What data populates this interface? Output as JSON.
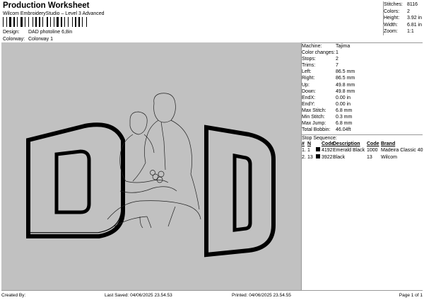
{
  "header": {
    "title": "Production Worksheet",
    "subtitle": "Wilcom EmbroideryStudio – Level 3 Advanced",
    "stats": [
      {
        "label": "Stitches:",
        "value": "8116"
      },
      {
        "label": "Colors:",
        "value": "2"
      },
      {
        "label": "Height:",
        "value": "3.92 in"
      },
      {
        "label": "Width:",
        "value": "6.81 in"
      },
      {
        "label": "Zoom:",
        "value": "1:1"
      }
    ]
  },
  "meta": {
    "design_label": "Design:",
    "design_value": "DAD photoline 6,8in",
    "colorway_label": "Colorway:",
    "colorway_value": "Colorway 1"
  },
  "machine_info": [
    {
      "label": "Machine:",
      "value": "Tajima"
    },
    {
      "label": "Color changes:",
      "value": "1"
    },
    {
      "label": "Stops:",
      "value": "2"
    },
    {
      "label": "Trims:",
      "value": "7"
    },
    {
      "label": "Left:",
      "value": "86.5 mm"
    },
    {
      "label": "Right:",
      "value": "86.5 mm"
    },
    {
      "label": "Up:",
      "value": "49.8 mm"
    },
    {
      "label": "Down:",
      "value": "49.8 mm"
    },
    {
      "label": "EndX:",
      "value": "0.00 in"
    },
    {
      "label": "EndY:",
      "value": "0.00 in"
    },
    {
      "label": "Max Stitch:",
      "value": "6.8 mm"
    },
    {
      "label": "Min Stitch:",
      "value": "0.3 mm"
    },
    {
      "label": "Max Jump:",
      "value": "6.8 mm"
    },
    {
      "label": "Total Bobbin:",
      "value": "46.04ft"
    }
  ],
  "stop_sequence": {
    "title": "Stop Sequence:",
    "headers": [
      "#",
      "N",
      "",
      "Code",
      "Description",
      "Code",
      "Brand"
    ],
    "rows": [
      {
        "num": "1.",
        "n": "1",
        "code": "4192",
        "description": "Emerald Black",
        "code2": "1000",
        "brand": "Madeira Classic 40",
        "color": "#000000"
      },
      {
        "num": "2.",
        "n": "13",
        "code": "3922",
        "description": "Black",
        "code2": "13",
        "brand": "Wilcom",
        "color": "#000000"
      }
    ]
  },
  "footer": {
    "created_by": "Created By:",
    "last_saved": "Last Saved: 04/06/2025 23.54.53",
    "printed": "Printed: 04/06/2025 23.54.55",
    "page": "Page 1 of 1"
  }
}
